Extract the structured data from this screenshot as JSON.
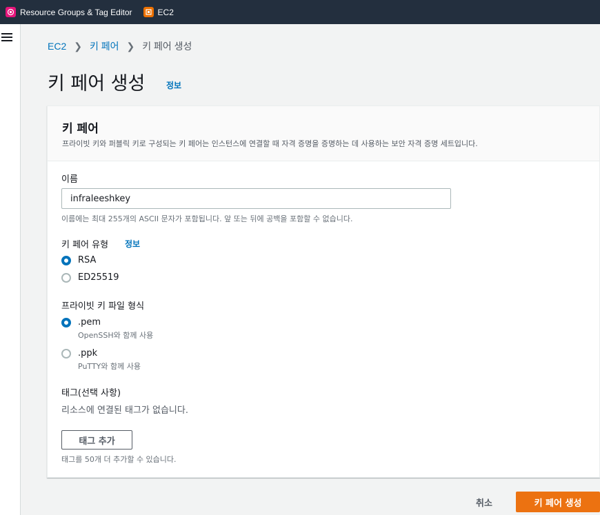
{
  "topbar": {
    "favorites": [
      {
        "label": "Resource Groups & Tag Editor",
        "icon": "resource-groups-icon",
        "color": "#e7157b"
      },
      {
        "label": "EC2",
        "icon": "ec2-icon",
        "color": "#ed7100"
      }
    ]
  },
  "breadcrumb": {
    "items": [
      "EC2",
      "키 페어",
      "키 페어 생성"
    ]
  },
  "page": {
    "title": "키 페어 생성",
    "info": "정보"
  },
  "panel": {
    "title": "키 페어",
    "description": "프라이빗 키와 퍼블릭 키로 구성되는 키 페어는 인스턴스에 연결할 때 자격 증명을 증명하는 데 사용하는 보안 자격 증명 세트입니다."
  },
  "name_field": {
    "label": "이름",
    "value": "infraleeshkey",
    "hint": "이름에는 최대 255개의 ASCII 문자가 포함됩니다. 앞 또는 뒤에 공백을 포함할 수 없습니다."
  },
  "key_type": {
    "label": "키 페어 유형",
    "info": "정보",
    "options": [
      {
        "label": "RSA",
        "selected": true
      },
      {
        "label": "ED25519",
        "selected": false
      }
    ]
  },
  "file_format": {
    "label": "프라이빗 키 파일 형식",
    "options": [
      {
        "label": ".pem",
        "sub": "OpenSSH와 함께 사용",
        "selected": true
      },
      {
        "label": ".ppk",
        "sub": "PuTTY와 함께 사용",
        "selected": false
      }
    ]
  },
  "tags": {
    "label": "태그(선택 사항)",
    "empty_text": "리소스에 연결된 태그가 없습니다.",
    "add_button": "태그 추가",
    "hint": "태그를 50개 더 추가할 수 있습니다."
  },
  "actions": {
    "cancel": "취소",
    "create": "키 페어 생성"
  },
  "colors": {
    "accent": "#0073bb",
    "primary_button": "#ec7211",
    "topbar": "#232f3e"
  }
}
